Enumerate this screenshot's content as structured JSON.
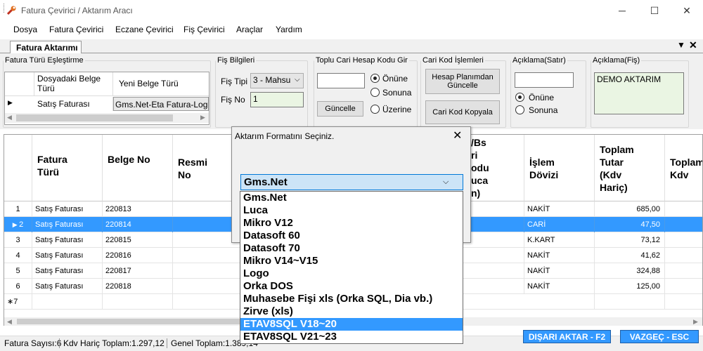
{
  "window": {
    "title": "Fatura Çevirici / Aktarım Aracı",
    "minimize": "─",
    "maximize": "☐",
    "close": "✕"
  },
  "menu": [
    "Dosya",
    "Fatura Çevirici",
    "Eczane Çevirici",
    "Fiş Çevirici",
    "Araçlar",
    "Yardım"
  ],
  "tab": {
    "label": "Fatura Aktarımı",
    "chevron": "▼",
    "close": "✕"
  },
  "mapping": {
    "legend": "Fatura Türü Eşleştirme",
    "col1": "Dosyadaki Belge Türü",
    "col2": "Yeni Belge Türü",
    "row_marker": "▶",
    "row_doc": "Satış Faturası",
    "row_new": "Gms.Net-Eta Fatura-Log"
  },
  "fis": {
    "legend": "Fiş Bilgileri",
    "tip_label": "Fiş Tipi",
    "tip_value": "3 - Mahsu",
    "no_label": "Fiş No",
    "no_value": "1"
  },
  "toplu": {
    "legend": "Toplu Cari Hesap Kodu Gir",
    "code_value": "",
    "button": "Güncelle",
    "options": [
      "Önüne",
      "Sonuna",
      "Üzerine"
    ],
    "selected": 0
  },
  "cari": {
    "legend": "Cari Kod İşlemleri",
    "btn1": "Hesap Planımdan Güncelle",
    "btn2": "Cari Kod Kopyala"
  },
  "aciklama_satir": {
    "legend": "Açıklama(Satır)",
    "value": "",
    "options": [
      "Önüne",
      "Sonuna"
    ],
    "selected": 0
  },
  "aciklama_fis": {
    "legend": "Açıklama(Fiş)",
    "value": "DEMO AKTARIM"
  },
  "grid": {
    "headers": [
      "Fatura\nTürü",
      "Belge No",
      "Resmi\nNo",
      "/Bs\nri\nodu\nuca\nn)",
      "İşlem\nDövizi",
      "Toplam\nTutar\n(Kdv\nHariç)",
      "Toplam\nKdv"
    ],
    "rows": [
      {
        "n": "1",
        "tur": "Satış Faturası",
        "no": "220813",
        "doviz": "NAKİT",
        "tutar": "685,00"
      },
      {
        "n": "2",
        "tur": "Satış Faturası",
        "no": "220814",
        "doviz": "CARİ",
        "tutar": "47,50",
        "selected": true
      },
      {
        "n": "3",
        "tur": "Satış Faturası",
        "no": "220815",
        "doviz": "K.KART",
        "tutar": "73,12"
      },
      {
        "n": "4",
        "tur": "Satış Faturası",
        "no": "220816",
        "doviz": "NAKİT",
        "tutar": "41,62"
      },
      {
        "n": "5",
        "tur": "Satış Faturası",
        "no": "220817",
        "doviz": "NAKİT",
        "tutar": "324,88"
      },
      {
        "n": "6",
        "tur": "Satış Faturası",
        "no": "220818",
        "doviz": "NAKİT",
        "tutar": "125,00"
      }
    ],
    "new_row": "∗7"
  },
  "status": {
    "fatura": "Fatura Sayısı:6",
    "kdv_haric": "Kdv Hariç Toplam:1.297,12",
    "genel": "Genel Toplam:1.389,14",
    "export": "DIŞARI AKTAR - F2",
    "cancel": "VAZGEÇ - ESC"
  },
  "dialog": {
    "title": "Aktarım Formatını Seçiniz.",
    "close": "✕",
    "selected": "Gms.Net",
    "options": [
      "Gms.Net",
      "Luca",
      "Mikro V12",
      "Datasoft 60",
      "Datasoft 70",
      "Mikro V14~V15",
      "Logo",
      "Orka DOS",
      "Muhasebe Fişi xls (Orka SQL, Dia vb.)",
      "Zirve (xls)",
      "ETAV8SQL V18~20",
      "ETAV8SQL V21~23"
    ],
    "highlighted_index": 10
  },
  "colors": {
    "selection": "#3399ff",
    "accent": "#0078d7"
  }
}
